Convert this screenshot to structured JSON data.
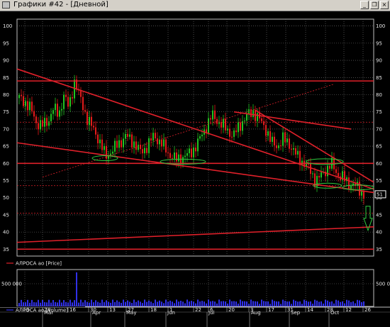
{
  "window": {
    "title": "Графики #42 - [Дневной]",
    "buttons": {
      "minimize": "_",
      "restore": "❐",
      "close": "×"
    }
  },
  "chart_data": [
    {
      "type": "candlestick",
      "legend": "АЛРОСА ао [Price]",
      "y_ticks": [
        100,
        95,
        90,
        85,
        80,
        75,
        70,
        65,
        60,
        55,
        50,
        45,
        40,
        35
      ],
      "ylim": [
        33,
        102
      ],
      "last_price_label": "51",
      "colors": {
        "up": "#22c322",
        "down": "#e41b1b",
        "trendline": "#e0202a",
        "marker": "#2ecc40",
        "grid": "#7a7a7a",
        "background": "#000000",
        "axis_text": "#e6e6e6"
      }
    },
    {
      "type": "bar",
      "legend": "АЛРОСА ао [Volume]",
      "y_ticks": [
        "500 000"
      ],
      "colors": {
        "bar": "#3030e8"
      }
    }
  ],
  "x_axis": {
    "day_labels": [
      "9",
      "24",
      "16",
      "30",
      "13",
      "27",
      "18",
      "1",
      "22",
      "6",
      "20",
      "3",
      "17",
      "31",
      "14",
      "28",
      "12",
      "26"
    ],
    "month_labels": [
      "Mar",
      "Apr",
      "May",
      "Jun",
      "Jul",
      "Aug",
      "Sep",
      "Oct"
    ]
  }
}
